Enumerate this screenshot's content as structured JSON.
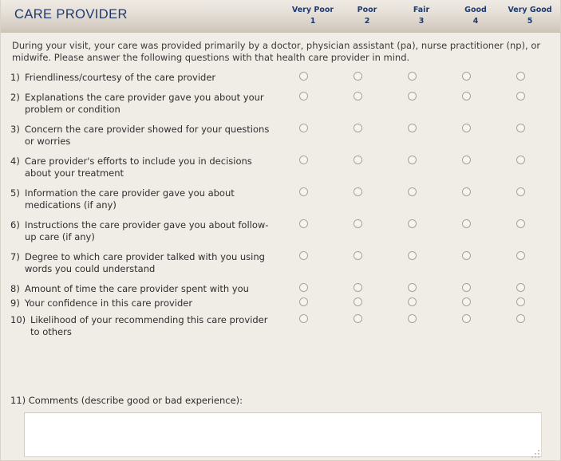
{
  "header": {
    "title": "CARE PROVIDER",
    "scale": [
      {
        "label": "Very Poor",
        "value": "1"
      },
      {
        "label": "Poor",
        "value": "2"
      },
      {
        "label": "Fair",
        "value": "3"
      },
      {
        "label": "Good",
        "value": "4"
      },
      {
        "label": "Very Good",
        "value": "5"
      }
    ]
  },
  "intro": "During your visit, your care was provided primarily by a doctor, physician assistant (pa), nurse practitioner (np), or midwife. Please answer the following questions with that health care provider in mind.",
  "questions": [
    {
      "num": "1)",
      "text": "Friendliness/courtesy of the care provider",
      "selected": null
    },
    {
      "num": "2)",
      "text": "Explanations the care provider gave you about your problem or condition",
      "selected": null
    },
    {
      "num": "3)",
      "text": "Concern the care provider showed for your questions or worries",
      "selected": null
    },
    {
      "num": "4)",
      "text": "Care provider's efforts to include you in decisions about your treatment",
      "selected": null
    },
    {
      "num": "5)",
      "text": "Information the care provider gave you about medications (if any)",
      "selected": null
    },
    {
      "num": "6)",
      "text": "Instructions the care provider gave you about follow-up care (if any)",
      "selected": null
    },
    {
      "num": "7)",
      "text": "Degree to which care provider talked with you using words you could understand",
      "selected": null
    },
    {
      "num": "8)",
      "text": "Amount of time the care provider spent with you",
      "selected": null
    },
    {
      "num": "9)",
      "text": "Your confidence in this care provider",
      "selected": null
    },
    {
      "num": "10)",
      "text": "Likelihood of your recommending this care provider to others",
      "selected": null
    }
  ],
  "comments": {
    "num": "11)",
    "label": "11) Comments (describe good or bad experience):",
    "value": "",
    "placeholder": ""
  },
  "colors": {
    "title": "#1f3a6e",
    "panel_background": "#f0ece6",
    "header_gradient_top": "#efeae4",
    "header_gradient_bottom": "#cdc4b8",
    "body_text": "#2e2e2e",
    "radio_border": "#a9a29a",
    "textarea_background": "#ffffff"
  }
}
